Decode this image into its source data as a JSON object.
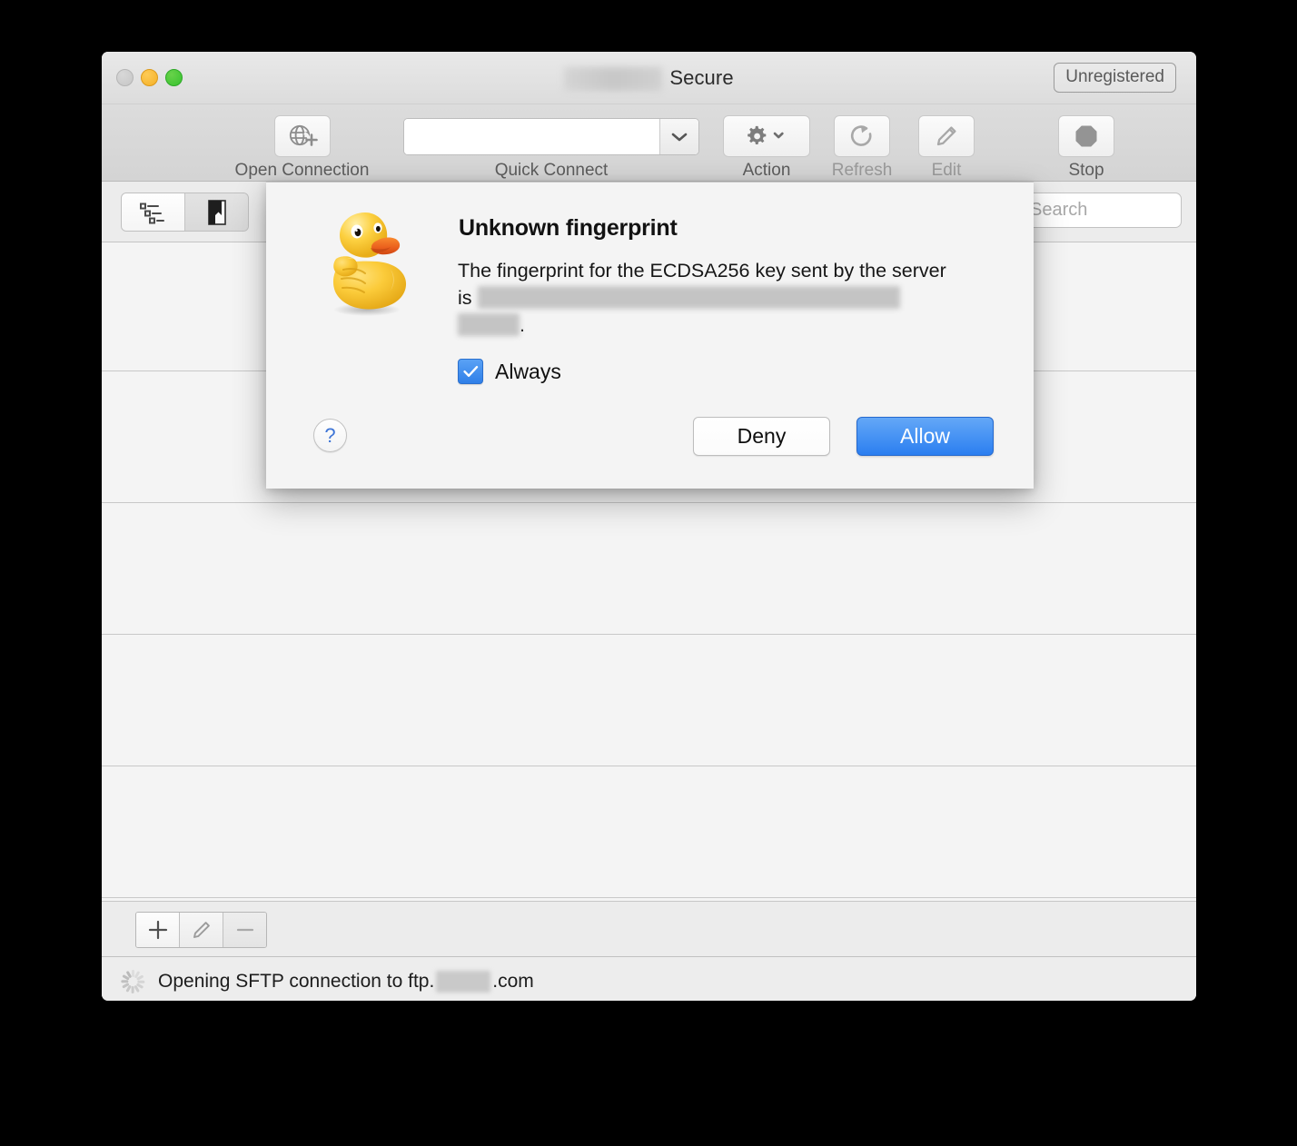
{
  "window": {
    "title_prefix_redacted": true,
    "title": "Secure",
    "registration_badge": "Unregistered"
  },
  "toolbar": {
    "open_connection": {
      "label": "Open Connection",
      "icon": "globe-plus-icon"
    },
    "quick_connect": {
      "label": "Quick Connect",
      "value": "",
      "placeholder": ""
    },
    "action": {
      "label": "Action",
      "icon": "gear-icon"
    },
    "refresh": {
      "label": "Refresh",
      "icon": "refresh-icon",
      "disabled": true
    },
    "edit": {
      "label": "Edit",
      "icon": "pencil-icon",
      "disabled": true
    },
    "stop": {
      "label": "Stop",
      "icon": "stop-octagon-icon"
    }
  },
  "bookmark_bar": {
    "segments": [
      {
        "name": "list-view",
        "icon": "outline-list-icon",
        "selected": true
      },
      {
        "name": "bookmark-view",
        "icon": "bookmark-icon",
        "selected": false
      }
    ],
    "search": {
      "placeholder": "Search",
      "value": ""
    }
  },
  "list": {
    "row_count": 5
  },
  "bottom_bar": {
    "buttons": [
      {
        "name": "add-bookmark",
        "icon": "plus-icon"
      },
      {
        "name": "edit-bookmark",
        "icon": "pencil-icon"
      },
      {
        "name": "remove-bookmark",
        "icon": "minus-icon"
      }
    ]
  },
  "status_bar": {
    "spinner": "loading-spinner-icon",
    "text_before": "Opening SFTP connection to ftp.",
    "redacted_domain": true,
    "text_after": ".com"
  },
  "dialog": {
    "icon": "rubber-duck-icon",
    "title": "Unknown fingerprint",
    "body_line1": "The fingerprint for the ECDSA256 key sent by the",
    "body_line2_prefix": "server is",
    "body_line3_suffix": ".",
    "checkbox": {
      "label": "Always",
      "checked": true
    },
    "help_button": "?",
    "deny_button": "Deny",
    "allow_button": "Allow"
  },
  "colors": {
    "accent_blue": "#2b7ef0",
    "window_bg": "#f4f4f4",
    "toolbar_bg": "#d8d8d8"
  }
}
